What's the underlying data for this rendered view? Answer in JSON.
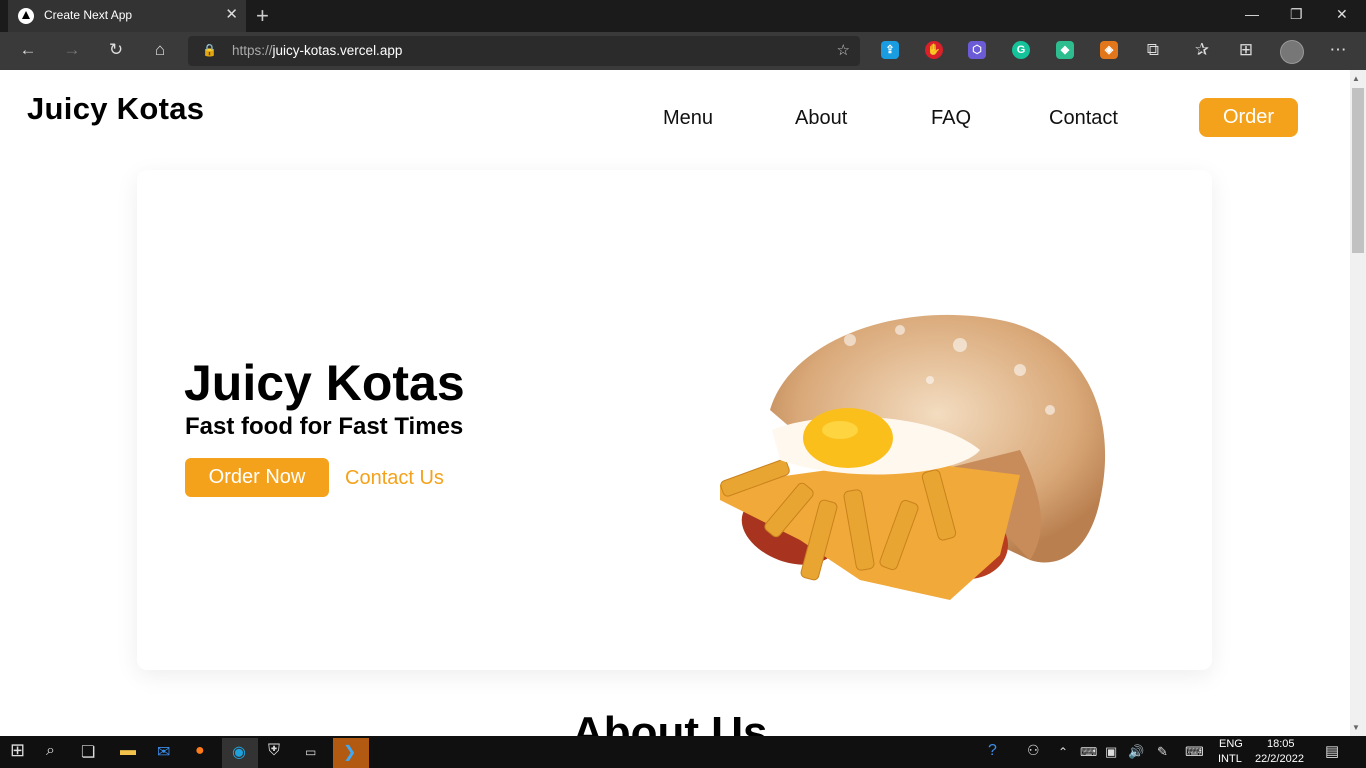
{
  "browser": {
    "tab_title": "Create Next App",
    "url_scheme": "https://",
    "url_host": "juicy-kotas.vercel.app",
    "window_controls": [
      "—",
      "❐",
      "✕"
    ]
  },
  "site": {
    "brand": "Juicy Kotas",
    "nav": [
      "Menu",
      "About",
      "FAQ",
      "Contact"
    ],
    "order_label": "Order"
  },
  "hero": {
    "title": "Juicy Kotas",
    "subtitle": "Fast food for Fast Times",
    "order_now": "Order Now",
    "contact_us": "Contact Us",
    "image_label": "kota-sandwich-image"
  },
  "about": {
    "heading": "About Us"
  },
  "taskbar": {
    "lang_top": "ENG",
    "lang_bottom": "INTL",
    "time": "18:05",
    "date": "22/2/2022"
  },
  "colors": {
    "accent": "#f4a21b",
    "browser_dark": "#202124",
    "taskbar": "#101010"
  }
}
